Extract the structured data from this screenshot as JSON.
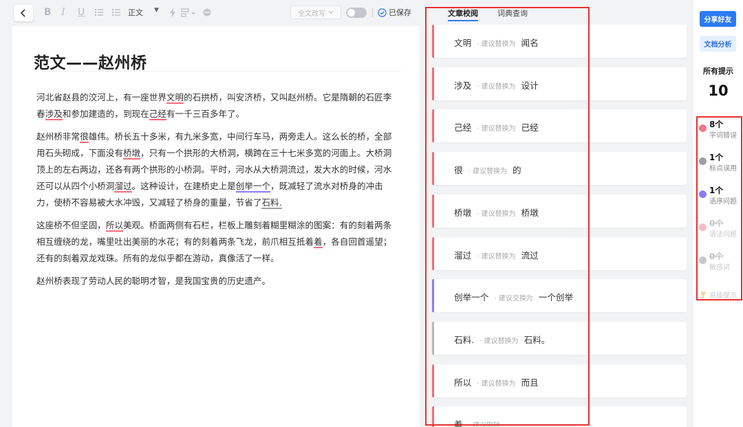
{
  "toolbar": {
    "style_label": "正文",
    "rewrite_label": "全文改写",
    "saved_label": "已保存"
  },
  "document": {
    "title": "范文——赵州桥",
    "paragraphs": [
      {
        "lines": [
          [
            {
              "t": "河北省赵县的洨河上，有一座世界"
            },
            {
              "t": "文明",
              "e": "red"
            },
            {
              "t": "的石拱桥，叫安济桥，又叫赵州桥。它是隋朝的石匠李"
            }
          ],
          [
            {
              "t": "春"
            },
            {
              "t": "涉及",
              "e": "red"
            },
            {
              "t": "和参加建造的，到现在"
            },
            {
              "t": "己经",
              "e": "red"
            },
            {
              "t": "有一千三百多年了。"
            }
          ]
        ]
      },
      {
        "lines": [
          [
            {
              "t": "赵州桥非常"
            },
            {
              "t": "很",
              "e": "red"
            },
            {
              "t": "雄伟。桥长五十多米，有九米多宽，中间行车马，两旁走人。这么长的桥，全部"
            }
          ],
          [
            {
              "t": "用石头砌成，下面没有"
            },
            {
              "t": "桥墩",
              "e": "red"
            },
            {
              "t": "，只有一个拱形的大桥洞，横跨在三十七米多宽的河面上。大桥洞"
            }
          ],
          [
            {
              "t": "顶上的左右两边，还各有两个拱形的小桥洞。平时，河水从大桥洞流过，发大水的时候，河水"
            }
          ],
          [
            {
              "t": "还可以从四个小桥洞"
            },
            {
              "t": "溜过",
              "e": "red"
            },
            {
              "t": "。这种设计，在建桥史上是"
            },
            {
              "t": "创举一个",
              "e": "purple"
            },
            {
              "t": "，既减轻了流水对桥身的冲击"
            }
          ],
          [
            {
              "t": "力，使桥不容易被大水冲毁，又减轻了桥身的重量，节省了"
            },
            {
              "t": "石料.",
              "e": "gray"
            }
          ]
        ]
      },
      {
        "lines": [
          [
            {
              "t": "这座桥不但坚固，"
            },
            {
              "t": "所以",
              "e": "red"
            },
            {
              "t": "美观。桥面两侧有石栏，栏板上雕刻着糊里糊涂的图案：有的刻着两条"
            }
          ],
          [
            {
              "t": "相互缠绕的龙，嘴里吐出美丽的水花；有的刻着两条飞龙，前爪相互抵着"
            },
            {
              "t": "着",
              "e": "red"
            },
            {
              "t": "，各自回首遥望；"
            }
          ],
          [
            {
              "t": "还有的刻着双龙戏珠。所有的龙似乎都在游动，真像活了一样。"
            }
          ]
        ]
      },
      {
        "lines": [
          [
            {
              "t": "赵州桥表现了劳动人民的聪明才智，是我国宝贵的历史遗产。"
            }
          ]
        ]
      }
    ]
  },
  "panel": {
    "tabs": [
      "文章校阅",
      "词典查询"
    ],
    "suggestions": [
      {
        "orig": "文明",
        "hint": "· 建议替换为",
        "sugg": "闻名",
        "color": "#f26d7d"
      },
      {
        "orig": "涉及",
        "hint": "· 建议替换为",
        "sugg": "设计",
        "color": "#f26d7d"
      },
      {
        "orig": "己经",
        "hint": "· 建议替换为",
        "sugg": "已经",
        "color": "#f26d7d"
      },
      {
        "orig": "很",
        "hint": "· 建议替换为",
        "sugg": "的",
        "color": "#f26d7d"
      },
      {
        "orig": "桥墩",
        "hint": "· 建议替换为",
        "sugg": "桥墩",
        "color": "#f26d7d"
      },
      {
        "orig": "溜过",
        "hint": "· 建议替换为",
        "sugg": "流过",
        "color": "#f26d7d"
      },
      {
        "orig": "创举一个",
        "hint": "· 建议交换为",
        "sugg": "一个创举",
        "color": "#8b7cf5"
      },
      {
        "orig": "石料.",
        "hint": "· 建议替换为",
        "sugg": "石料。",
        "color": "#b4b8be"
      },
      {
        "orig": "所以",
        "hint": "· 建议替换为",
        "sugg": "而且",
        "color": "#f26d7d"
      },
      {
        "orig": "着",
        "hint": "· 建议删除",
        "sugg": "",
        "color": "#f26d7d"
      }
    ]
  },
  "rail": {
    "share_label": "分享好友",
    "analysis_label": "文档分析",
    "all_label": "所有提示",
    "all_count": "10",
    "categories": [
      {
        "count": "8个",
        "label": "字词错误",
        "color": "#f07a86",
        "dim": false
      },
      {
        "count": "1个",
        "label": "标点误用",
        "color": "#9aa0a6",
        "dim": false
      },
      {
        "count": "1个",
        "label": "语序问题",
        "color": "#8b7cf5",
        "dim": false
      },
      {
        "count": "0个",
        "label": "语法问题",
        "color": "#f6bcc6",
        "dim": true
      },
      {
        "count": "0个",
        "label": "敏感词",
        "color": "#c8c8c8",
        "dim": true
      }
    ],
    "advanced_label": "高级提示"
  }
}
